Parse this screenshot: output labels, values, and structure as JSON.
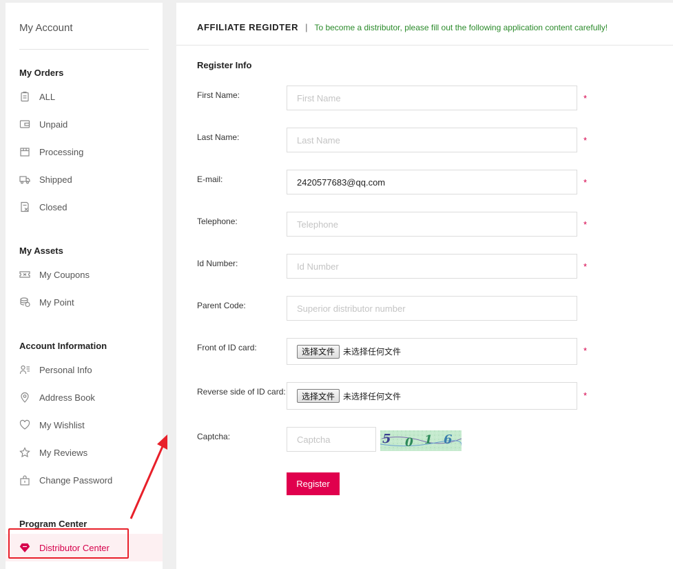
{
  "sidebar": {
    "account_title": "My Account",
    "orders": {
      "heading": "My Orders",
      "items": [
        {
          "label": "ALL",
          "icon": "clipboard-icon"
        },
        {
          "label": "Unpaid",
          "icon": "wallet-icon"
        },
        {
          "label": "Processing",
          "icon": "box-icon"
        },
        {
          "label": "Shipped",
          "icon": "truck-icon"
        },
        {
          "label": "Closed",
          "icon": "closed-doc-icon"
        }
      ]
    },
    "assets": {
      "heading": "My Assets",
      "items": [
        {
          "label": "My Coupons",
          "icon": "coupon-icon"
        },
        {
          "label": "My Point",
          "icon": "coins-icon"
        }
      ]
    },
    "account_info": {
      "heading": "Account Information",
      "items": [
        {
          "label": "Personal Info",
          "icon": "user-card-icon"
        },
        {
          "label": "Address Book",
          "icon": "location-pin-icon"
        },
        {
          "label": "My Wishlist",
          "icon": "heart-icon"
        },
        {
          "label": "My Reviews",
          "icon": "star-icon"
        },
        {
          "label": "Change Password",
          "icon": "lock-icon"
        }
      ]
    },
    "program": {
      "heading": "Program Center",
      "items": [
        {
          "label": "Distributor Center",
          "icon": "diamond-heart-icon",
          "active": true
        }
      ]
    }
  },
  "header": {
    "title": "AFFILIATE REGIDTER",
    "separator": "|",
    "subtitle": "To become a distributor, please fill out the following application content carefully!"
  },
  "form": {
    "section_title": "Register Info",
    "required_mark": "*",
    "fields": {
      "first_name": {
        "label": "First Name:",
        "placeholder": "First Name",
        "value": ""
      },
      "last_name": {
        "label": "Last Name:",
        "placeholder": "Last Name",
        "value": ""
      },
      "email": {
        "label": "E-mail:",
        "placeholder": "",
        "value": "2420577683@qq.com"
      },
      "telephone": {
        "label": "Telephone:",
        "placeholder": "Telephone",
        "value": ""
      },
      "id_number": {
        "label": "Id Number:",
        "placeholder": "Id Number",
        "value": ""
      },
      "parent_code": {
        "label": "Parent Code:",
        "placeholder": "Superior distributor number",
        "value": ""
      },
      "front_id": {
        "label": "Front of ID card:",
        "button": "选择文件",
        "status": "未选择任何文件"
      },
      "reverse_id": {
        "label": "Reverse side of ID card:",
        "button": "选择文件",
        "status": "未选择任何文件"
      },
      "captcha": {
        "label": "Captcha:",
        "placeholder": "Captcha",
        "value": "",
        "image_text": "5016"
      }
    },
    "submit_label": "Register"
  },
  "colors": {
    "accent": "#e0004d",
    "header_subtitle": "#2a8a2a",
    "annotation": "#e8202a"
  }
}
